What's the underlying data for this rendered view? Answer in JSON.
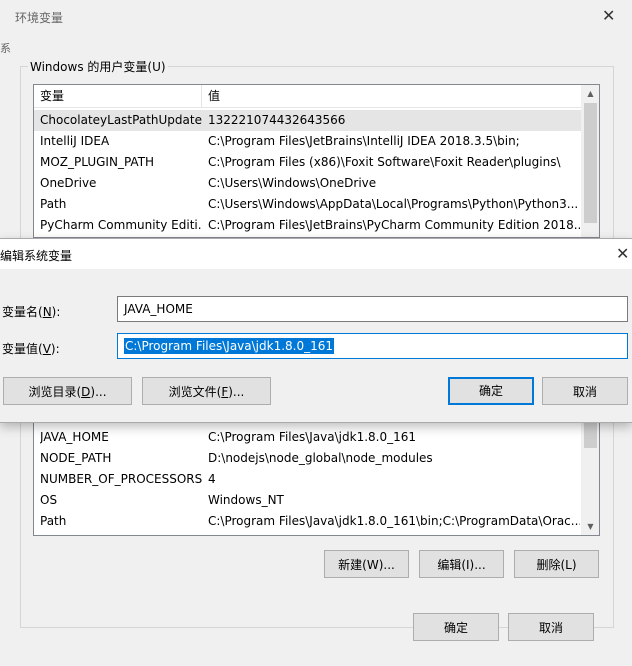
{
  "env_dialog": {
    "title": "环境变量",
    "left_peek_1": "系",
    "left_peek_2": "",
    "user_group_label": "Windows 的用户变量(U)",
    "user_columns": [
      "变量",
      "值"
    ],
    "user_rows": [
      {
        "name": "ChocolateyLastPathUpdate",
        "value": "132221074432643566"
      },
      {
        "name": "IntelliJ IDEA",
        "value": "C:\\Program Files\\JetBrains\\IntelliJ IDEA 2018.3.5\\bin;"
      },
      {
        "name": "MOZ_PLUGIN_PATH",
        "value": "C:\\Program Files (x86)\\Foxit Software\\Foxit Reader\\plugins\\"
      },
      {
        "name": "OneDrive",
        "value": "C:\\Users\\Windows\\OneDrive"
      },
      {
        "name": "Path",
        "value": "C:\\Users\\Windows\\AppData\\Local\\Programs\\Python\\Python3..."
      },
      {
        "name": "PyCharm Community Editi...",
        "value": "C:\\Program Files\\JetBrains\\PyCharm Community Edition 2018...."
      }
    ],
    "system_rows": [
      {
        "name": "JAVA_HOME",
        "value": "C:\\Program Files\\Java\\jdk1.8.0_161"
      },
      {
        "name": "NODE_PATH",
        "value": "D:\\nodejs\\node_global\\node_modules"
      },
      {
        "name": "NUMBER_OF_PROCESSORS",
        "value": "4"
      },
      {
        "name": "OS",
        "value": "Windows_NT"
      },
      {
        "name": "Path",
        "value": "C:\\Program Files\\Java\\jdk1.8.0_161\\bin;C:\\ProgramData\\Orac..."
      }
    ],
    "new_button": "新建(W)...",
    "edit_button": "编辑(I)...",
    "delete_button": "删除(L)",
    "ok_button": "确定",
    "cancel_button": "取消"
  },
  "edit_dialog": {
    "title": "编辑系统变量",
    "name_label_prefix": "变量名(",
    "name_label_key": "N",
    "name_label_suffix": "):",
    "value_label_prefix": "变量值(",
    "value_label_key": "V",
    "value_label_suffix": "):",
    "name_value": "JAVA_HOME",
    "value_value": "C:\\Program Files\\Java\\jdk1.8.0_161",
    "browse_dir_prefix": "浏览目录(",
    "browse_dir_key": "D",
    "browse_dir_suffix": ")...",
    "browse_file_prefix": "浏览文件(",
    "browse_file_key": "F",
    "browse_file_suffix": ")...",
    "ok_button": "确定",
    "cancel_button": "取消"
  }
}
